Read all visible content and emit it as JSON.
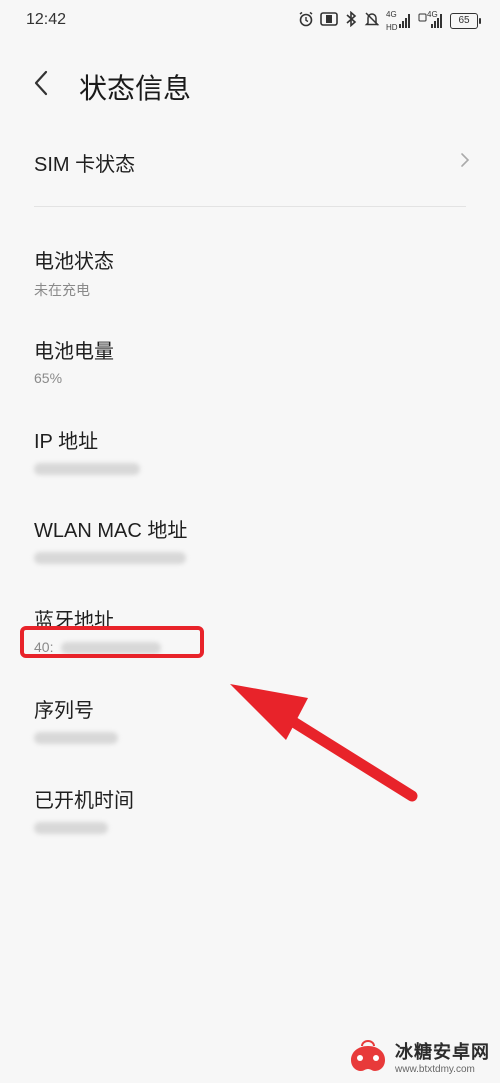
{
  "status_bar": {
    "time": "12:42",
    "network_label_1": "4G",
    "hd_label": "HD",
    "network_label_2": "4G",
    "battery_level": "65",
    "icons": [
      "alarm-icon",
      "vibrate-icon",
      "bluetooth-icon",
      "mute-icon",
      "signal-icon",
      "signal-icon",
      "battery-icon"
    ]
  },
  "header": {
    "title": "状态信息"
  },
  "items": {
    "sim": {
      "title": "SIM 卡状态"
    },
    "battery_status": {
      "title": "电池状态",
      "value": "未在充电"
    },
    "battery_level": {
      "title": "电池电量",
      "value": "65%"
    },
    "ip": {
      "title": "IP 地址"
    },
    "wlan_mac": {
      "title": "WLAN MAC 地址"
    },
    "bluetooth": {
      "title": "蓝牙地址",
      "value_prefix": "40:"
    },
    "serial": {
      "title": "序列号"
    },
    "uptime": {
      "title": "已开机时间"
    }
  },
  "annotation": {
    "color": "#e8232a"
  },
  "watermark": {
    "name": "冰糖安卓网",
    "url": "www.btxtdmy.com"
  }
}
